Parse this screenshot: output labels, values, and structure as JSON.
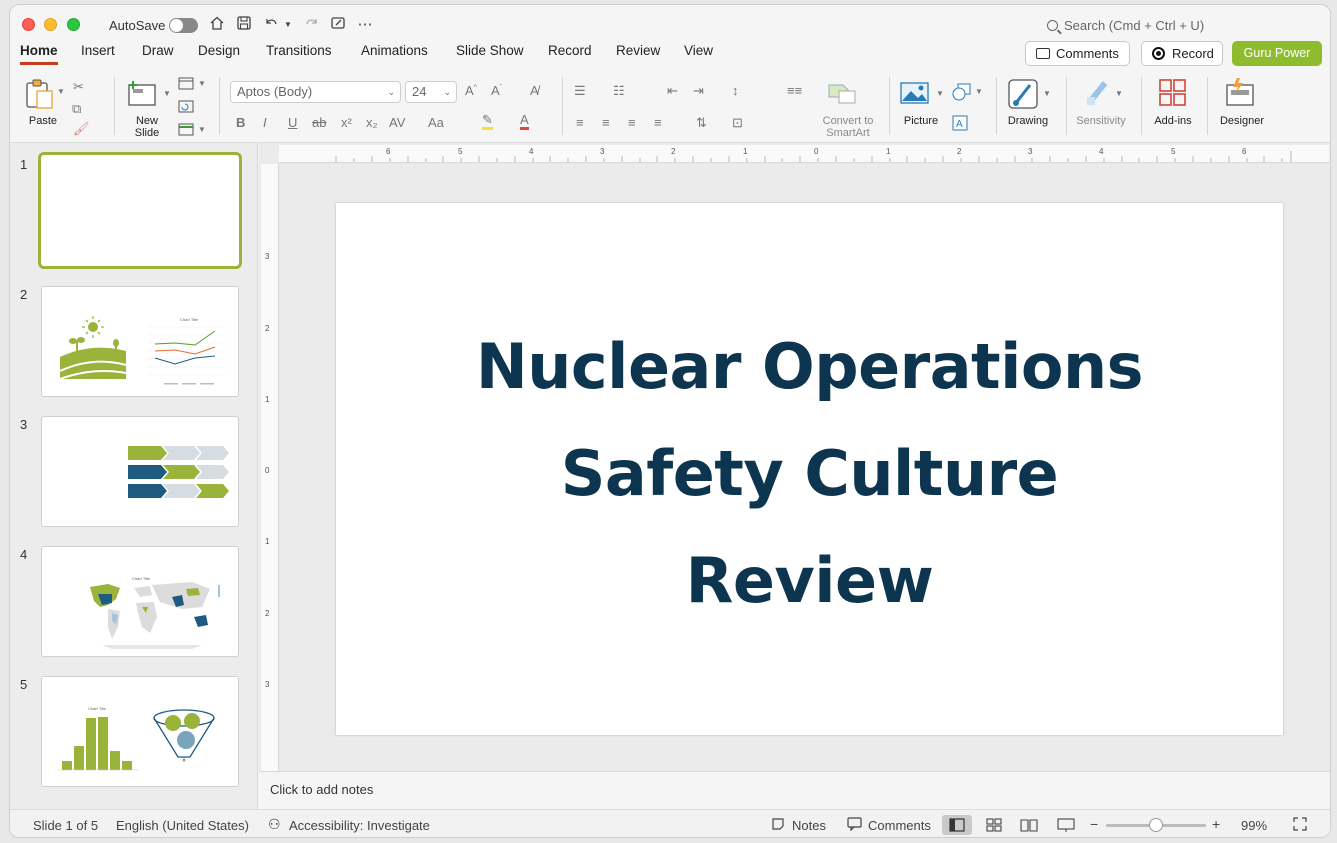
{
  "titlebar": {
    "autosave_label": "AutoSave",
    "autosave_on": false,
    "search_placeholder": "Search (Cmd + Ctrl + U)"
  },
  "tabs": [
    {
      "label": "Home",
      "active": true
    },
    {
      "label": "Insert"
    },
    {
      "label": "Draw"
    },
    {
      "label": "Design"
    },
    {
      "label": "Transitions"
    },
    {
      "label": "Animations"
    },
    {
      "label": "Slide Show"
    },
    {
      "label": "Record"
    },
    {
      "label": "Review"
    },
    {
      "label": "View"
    }
  ],
  "actions": {
    "comments_label": "Comments",
    "record_label": "Record",
    "guru_label": "Guru Power",
    "guru_color": "#8fbc2f"
  },
  "ribbon": {
    "paste_label": "Paste",
    "new_slide_label": "New\nSlide",
    "font_name": "Aptos (Body)",
    "font_size": "24",
    "convert_label": "Convert to\nSmartArt",
    "picture_label": "Picture",
    "drawing_label": "Drawing",
    "sensitivity_label": "Sensitivity",
    "addins_label": "Add-ins",
    "designer_label": "Designer"
  },
  "slides": [
    {
      "number": "1",
      "selected": true
    },
    {
      "number": "2"
    },
    {
      "number": "3"
    },
    {
      "number": "4"
    },
    {
      "number": "5"
    }
  ],
  "thumb_text": {
    "chart_title": "Chart Title"
  },
  "slide": {
    "title_lines": [
      "Nuclear Operations",
      "Safety Culture",
      "Review"
    ],
    "title_color": "#0d3550"
  },
  "rulers": {
    "top": [
      "6",
      "5",
      "4",
      "3",
      "2",
      "1",
      "0",
      "1",
      "2",
      "3",
      "4",
      "5",
      "6"
    ],
    "left": [
      "3",
      "2",
      "1",
      "0",
      "1",
      "2",
      "3"
    ]
  },
  "notes_placeholder": "Click to add notes",
  "status": {
    "slide_info": "Slide 1 of 5",
    "language": "English (United States)",
    "accessibility": "Accessibility: Investigate",
    "notes_label": "Notes",
    "comments_label": "Comments",
    "zoom": "99%",
    "zoom_fraction": 0.5
  },
  "colors": {
    "accent_green": "#9ab33a",
    "tab_underline": "#c43e1c",
    "navy": "#1f5a80"
  }
}
